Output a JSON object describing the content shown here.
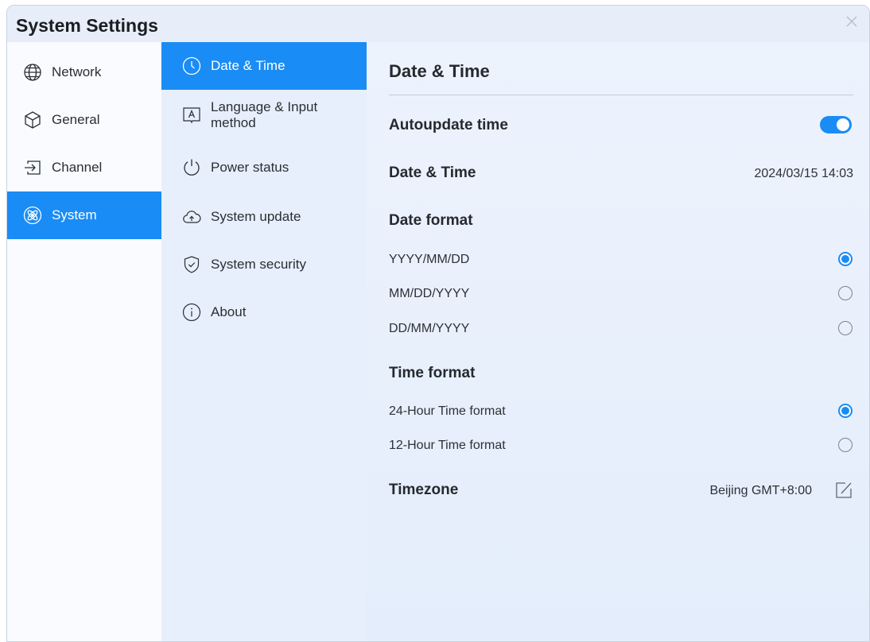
{
  "window": {
    "title": "System Settings"
  },
  "sidebar": {
    "items": [
      {
        "label": "Network",
        "icon": "globe-icon"
      },
      {
        "label": "General",
        "icon": "cube-icon"
      },
      {
        "label": "Channel",
        "icon": "input-icon"
      },
      {
        "label": "System",
        "icon": "atom-icon",
        "active": true
      }
    ]
  },
  "submenu": {
    "items": [
      {
        "label": "Date & Time",
        "icon": "clock-icon",
        "active": true
      },
      {
        "label": "Language & Input method",
        "icon": "language-icon"
      },
      {
        "label": "Power status",
        "icon": "power-icon"
      },
      {
        "label": "System update",
        "icon": "cloud-upload-icon"
      },
      {
        "label": "System security",
        "icon": "shield-icon"
      },
      {
        "label": "About",
        "icon": "info-icon"
      }
    ]
  },
  "content": {
    "title": "Date & Time",
    "autoupdate": {
      "label": "Autoupdate time",
      "enabled": true
    },
    "datetime": {
      "label": "Date & Time",
      "value": "2024/03/15 14:03"
    },
    "date_format": {
      "label": "Date format",
      "options": [
        {
          "label": "YYYY/MM/DD",
          "selected": true
        },
        {
          "label": "MM/DD/YYYY",
          "selected": false
        },
        {
          "label": "DD/MM/YYYY",
          "selected": false
        }
      ]
    },
    "time_format": {
      "label": "Time format",
      "options": [
        {
          "label": "24-Hour Time format",
          "selected": true
        },
        {
          "label": "12-Hour Time format",
          "selected": false
        }
      ]
    },
    "timezone": {
      "label": "Timezone",
      "value": "Beijing GMT+8:00"
    }
  },
  "colors": {
    "accent": "#1a8cf5"
  }
}
